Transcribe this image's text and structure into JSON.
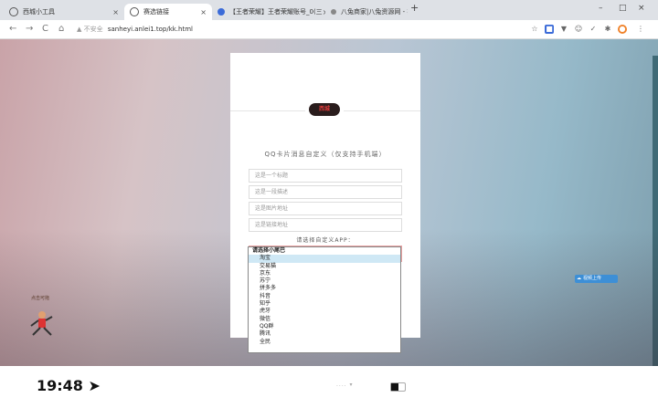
{
  "browser": {
    "tabs": [
      {
        "title": "西城小工具",
        "icon_color": "#555555"
      },
      {
        "title": "赛选链接",
        "icon_color": "#555555"
      },
      {
        "title": "【王者荣耀】王者荣耀账号_0(三",
        "icon_color": "#3b6bd8"
      },
      {
        "title": "八兔商家|八兔资源网 - 打造国内",
        "icon_color": "#888888"
      }
    ],
    "new_tab": "+",
    "url_warning": "▲ 不安全",
    "url": "sanheyi.anlei1.top/kk.html",
    "window_controls": [
      "–",
      "□",
      "×"
    ]
  },
  "page": {
    "logo_text": "西城",
    "subtitle": "QQ卡片消息自定义（仅支持手机端）",
    "fields": [
      {
        "placeholder": "这是一个标题"
      },
      {
        "placeholder": "这是一段描述"
      },
      {
        "placeholder": "这是图片地址"
      },
      {
        "placeholder": "这是链接地址"
      }
    ],
    "app_label": "请选择自定义APP：",
    "dropdown": {
      "header": "请选择小尾巴",
      "selected_index": 0,
      "options": [
        "淘宝",
        "交易猫",
        "京东",
        "苏宁",
        "拼多多",
        "抖音",
        "知乎",
        "虎牙",
        "微信",
        "QQ群",
        "腾讯",
        "全民"
      ]
    },
    "share_label": "视频上传",
    "mascot_caption": "点击可拖"
  },
  "status_bar": {
    "time": "19:48",
    "battery_level": 0.55
  }
}
